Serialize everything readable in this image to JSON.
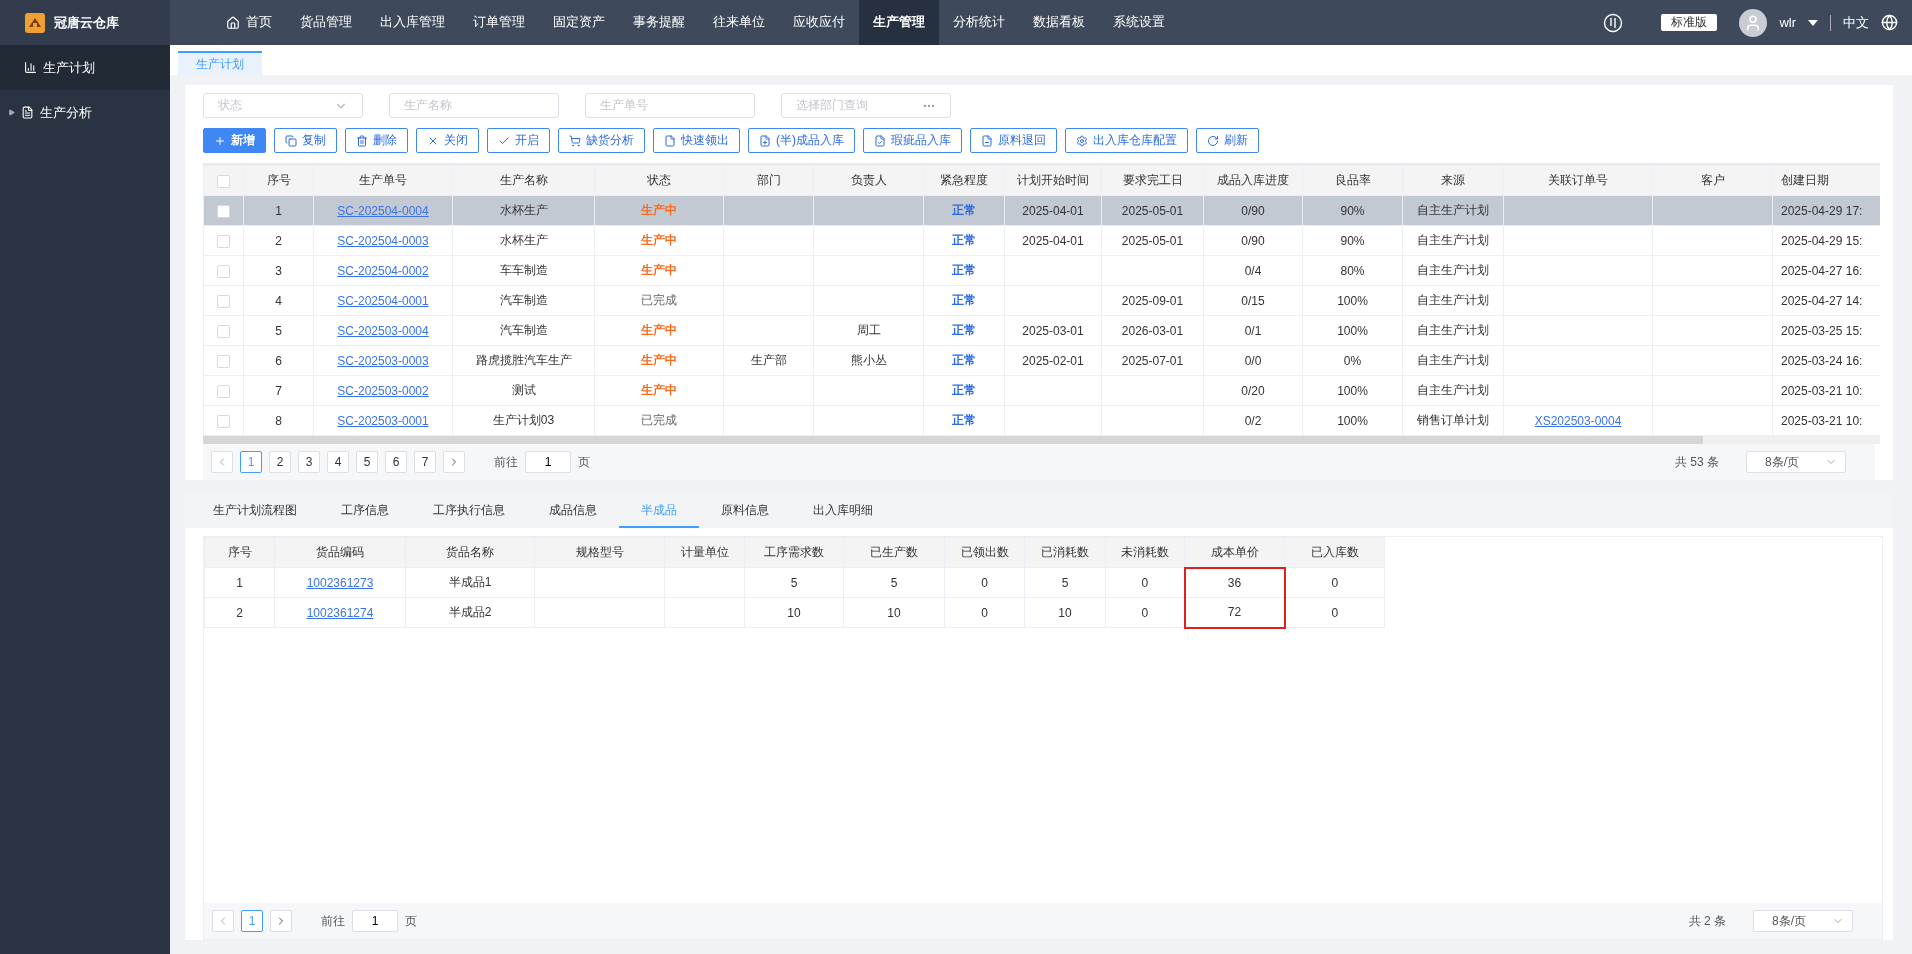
{
  "app": {
    "name": "冠唐云仓库"
  },
  "nav": [
    {
      "label": "首页",
      "selected": false
    },
    {
      "label": "货品管理",
      "selected": false
    },
    {
      "label": "出入库管理",
      "selected": false
    },
    {
      "label": "订单管理",
      "selected": false
    },
    {
      "label": "固定资产",
      "selected": false
    },
    {
      "label": "事务提醒",
      "selected": false
    },
    {
      "label": "往来单位",
      "selected": false
    },
    {
      "label": "应收应付",
      "selected": false
    },
    {
      "label": "生产管理",
      "selected": true
    },
    {
      "label": "分析统计",
      "selected": false
    },
    {
      "label": "数据看板",
      "selected": false
    },
    {
      "label": "系统设置",
      "selected": false
    }
  ],
  "header_right": {
    "edition": "标准版",
    "user": "wlr",
    "language": "中文"
  },
  "sidebar": {
    "items": [
      {
        "label": "生产计划",
        "selected": true,
        "kind": "page"
      },
      {
        "label": "生产分析",
        "selected": false,
        "kind": "group",
        "expanded": false
      }
    ]
  },
  "page_tabs": [
    {
      "label": "生产计划",
      "selected": true
    }
  ],
  "filters": [
    {
      "placeholder": "状态",
      "kind": "select"
    },
    {
      "placeholder": "生产名称",
      "kind": "text"
    },
    {
      "placeholder": "生产单号",
      "kind": "text"
    },
    {
      "placeholder": "选择部门查询",
      "kind": "picker"
    }
  ],
  "toolbar": [
    {
      "label": "新增",
      "kind": "primary"
    },
    {
      "label": "复制",
      "kind": "default"
    },
    {
      "label": "删除",
      "kind": "default"
    },
    {
      "label": "关闭",
      "kind": "default"
    },
    {
      "label": "开启",
      "kind": "default"
    },
    {
      "label": "缺货分析",
      "kind": "default"
    },
    {
      "label": "快速领出",
      "kind": "default"
    },
    {
      "label": "(半)成品入库",
      "kind": "default"
    },
    {
      "label": "瑕疵品入库",
      "kind": "default"
    },
    {
      "label": "原料退回",
      "kind": "default"
    },
    {
      "label": "出入库仓库配置",
      "kind": "default"
    },
    {
      "label": "刷新",
      "kind": "default"
    }
  ],
  "plan_table": {
    "header_checked": false,
    "columns": [
      "序号",
      "生产单号",
      "生产名称",
      "状态",
      "部门",
      "负责人",
      "紧急程度",
      "计划开始时间",
      "要求完工日",
      "成品入库进度",
      "良品率",
      "来源",
      "关联订单号",
      "客户",
      "创建日期"
    ],
    "rows": [
      {
        "selected": true,
        "checked": false,
        "no": "1",
        "order": "SC-202504-0004",
        "name": "水杯生产",
        "status": {
          "text": "生产中",
          "kind": "active"
        },
        "dept": "",
        "owner": "",
        "urgency": "正常",
        "start": "2025-04-01",
        "due": "2025-05-01",
        "progress": "0/90",
        "yield": "90%",
        "source": "自主生产计划",
        "linked": "",
        "customer": "",
        "created": "2025-04-29 17:"
      },
      {
        "selected": false,
        "checked": false,
        "no": "2",
        "order": "SC-202504-0003",
        "name": "水杯生产",
        "status": {
          "text": "生产中",
          "kind": "active"
        },
        "dept": "",
        "owner": "",
        "urgency": "正常",
        "start": "2025-04-01",
        "due": "2025-05-01",
        "progress": "0/90",
        "yield": "90%",
        "source": "自主生产计划",
        "linked": "",
        "customer": "",
        "created": "2025-04-29 15:"
      },
      {
        "selected": false,
        "checked": false,
        "no": "3",
        "order": "SC-202504-0002",
        "name": "车车制造",
        "status": {
          "text": "生产中",
          "kind": "active"
        },
        "dept": "",
        "owner": "",
        "urgency": "正常",
        "start": "",
        "due": "",
        "progress": "0/4",
        "yield": "80%",
        "source": "自主生产计划",
        "linked": "",
        "customer": "",
        "created": "2025-04-27 16:"
      },
      {
        "selected": false,
        "checked": false,
        "no": "4",
        "order": "SC-202504-0001",
        "name": "汽车制造",
        "status": {
          "text": "已完成",
          "kind": "done"
        },
        "dept": "",
        "owner": "",
        "urgency": "正常",
        "start": "",
        "due": "2025-09-01",
        "progress": "0/15",
        "yield": "100%",
        "source": "自主生产计划",
        "linked": "",
        "customer": "",
        "created": "2025-04-27 14:"
      },
      {
        "selected": false,
        "checked": false,
        "no": "5",
        "order": "SC-202503-0004",
        "name": "汽车制造",
        "status": {
          "text": "生产中",
          "kind": "active"
        },
        "dept": "",
        "owner": "周工",
        "urgency": "正常",
        "start": "2025-03-01",
        "due": "2026-03-01",
        "progress": "0/1",
        "yield": "100%",
        "source": "自主生产计划",
        "linked": "",
        "customer": "",
        "created": "2025-03-25 15:"
      },
      {
        "selected": false,
        "checked": false,
        "no": "6",
        "order": "SC-202503-0003",
        "name": "路虎揽胜汽车生产",
        "status": {
          "text": "生产中",
          "kind": "active"
        },
        "dept": "生产部",
        "owner": "熊小丛",
        "urgency": "正常",
        "start": "2025-02-01",
        "due": "2025-07-01",
        "progress": "0/0",
        "yield": "0%",
        "source": "自主生产计划",
        "linked": "",
        "customer": "",
        "created": "2025-03-24 16:"
      },
      {
        "selected": false,
        "checked": false,
        "no": "7",
        "order": "SC-202503-0002",
        "name": "测试",
        "status": {
          "text": "生产中",
          "kind": "active"
        },
        "dept": "",
        "owner": "",
        "urgency": "正常",
        "start": "",
        "due": "",
        "progress": "0/20",
        "yield": "100%",
        "source": "自主生产计划",
        "linked": "",
        "customer": "",
        "created": "2025-03-21 10:"
      },
      {
        "selected": false,
        "checked": false,
        "no": "8",
        "order": "SC-202503-0001",
        "name": "生产计划03",
        "status": {
          "text": "已完成",
          "kind": "done"
        },
        "dept": "",
        "owner": "",
        "urgency": "正常",
        "start": "",
        "due": "",
        "progress": "0/2",
        "yield": "100%",
        "source": "销售订单计划",
        "linked": "XS202503-0004",
        "customer": "",
        "created": "2025-03-21 10:"
      }
    ]
  },
  "plan_pagination": {
    "pages": [
      {
        "label": "1",
        "selected": true
      },
      {
        "label": "2",
        "selected": false
      },
      {
        "label": "3",
        "selected": false
      },
      {
        "label": "4",
        "selected": false
      },
      {
        "label": "5",
        "selected": false
      },
      {
        "label": "6",
        "selected": false
      },
      {
        "label": "7",
        "selected": false
      }
    ],
    "goto_label": "前往",
    "goto_value": "1",
    "goto_unit": "页",
    "total": "共 53 条",
    "page_size": "8条/页"
  },
  "detail_tabs": [
    {
      "label": "生产计划流程图",
      "selected": false
    },
    {
      "label": "工序信息",
      "selected": false
    },
    {
      "label": "工序执行信息",
      "selected": false
    },
    {
      "label": "成品信息",
      "selected": false
    },
    {
      "label": "半成品",
      "selected": true
    },
    {
      "label": "原料信息",
      "selected": false
    },
    {
      "label": "出入库明细",
      "selected": false
    }
  ],
  "detail_table": {
    "columns": [
      {
        "label": "序号",
        "highlighted": false
      },
      {
        "label": "货品编码",
        "highlighted": false
      },
      {
        "label": "货品名称",
        "highlighted": false
      },
      {
        "label": "规格型号",
        "highlighted": false
      },
      {
        "label": "计量单位",
        "highlighted": false
      },
      {
        "label": "工序需求数",
        "highlighted": false
      },
      {
        "label": "已生产数",
        "highlighted": false
      },
      {
        "label": "已领出数",
        "highlighted": false
      },
      {
        "label": "已消耗数",
        "highlighted": false
      },
      {
        "label": "未消耗数",
        "highlighted": false
      },
      {
        "label": "成本单价",
        "highlighted": true
      },
      {
        "label": "已入库数",
        "highlighted": false
      }
    ],
    "rows": [
      [
        "1",
        "1002361273",
        "半成品1",
        "",
        "",
        "5",
        "5",
        "0",
        "5",
        "0",
        "36",
        "0"
      ],
      [
        "2",
        "1002361274",
        "半成品2",
        "",
        "",
        "10",
        "10",
        "0",
        "10",
        "0",
        "72",
        "0"
      ]
    ]
  },
  "detail_pagination": {
    "pages": [
      {
        "label": "1",
        "selected": true
      }
    ],
    "goto_label": "前往",
    "goto_value": "1",
    "goto_unit": "页",
    "total": "共 2 条",
    "page_size": "8条/页"
  }
}
